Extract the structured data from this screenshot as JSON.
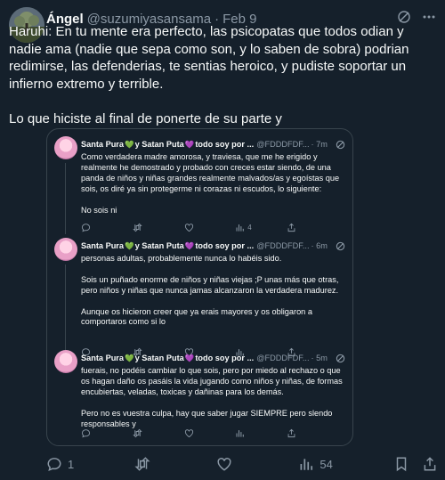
{
  "post": {
    "author_name": "Ángel",
    "author_handle": "@suzumiyasansama",
    "separator": "·",
    "date": "Feb 9",
    "text": "Haruhi: En tu mente era perfecto, las psicopatas que todos odian y nadie ama (nadie que sepa como son, y lo saben de sobra) podrian redimirse, las defenderias, te sentias heroico, y pudiste soportar un infierno extremo y terrible.\n\nLo que hiciste al final de ponerte de su parte y",
    "actions": {
      "reply_count": "1",
      "repost_count": "",
      "like_count": "",
      "views_count": "54"
    }
  },
  "quote": {
    "tweets": [
      {
        "name_part1": "Santa Pura",
        "name_part2": "y Satan Puta",
        "name_part3": "todo soy por ...",
        "handle": "@FDDDFDF...",
        "time": "· 7m",
        "text": "Como verdadera madre amorosa, y traviesa, que me he erigido y realmente he demostrado y probado con creces estar siendo, de una panda de niños y niñas grandes realmente malvados/as y egoístas que sois, os diré ya sin protegerme ni corazas ni escudos, lo siguiente:\n\nNo sois ni",
        "views": "4"
      },
      {
        "name_part1": "Santa Pura",
        "name_part2": "y Satan Puta",
        "name_part3": "todo soy por ...",
        "handle": "@FDDDFDF...",
        "time": "· 6m",
        "text": "personas adultas, probablemente nunca lo habéis sido.\n\nSois un puñado enorme de niños y niñas viejas ;P unas más que otras, pero niños y niñas que nunca jamas alcanzaron la verdadera madurez.\n\nAunque os hicieron creer que ya erais mayores y os obligaron a comportaros como si lo",
        "views": ""
      },
      {
        "name_part1": "Santa Pura",
        "name_part2": "y Satan Puta",
        "name_part3": "todo soy por ...",
        "handle": "@FDDDFDF...",
        "time": "· 5m",
        "text": "fuerais, no podéis cambiar lo que sois, pero por miedo al rechazo o que os hagan daño os pasáis la vida jugando como niños y niñas, de formas encubiertas, veladas, toxicas y dañinas para los demás.\n\nPero no es vuestra culpa, hay que saber jugar SIEMPRE pero slendo responsables y",
        "views": ""
      }
    ]
  },
  "icons": {
    "heart_green": "💚",
    "heart_purple": "💜"
  },
  "colors": {
    "background": "#15202b",
    "text": "#f7f9f9",
    "muted": "#8b98a5",
    "border": "#38444d"
  }
}
